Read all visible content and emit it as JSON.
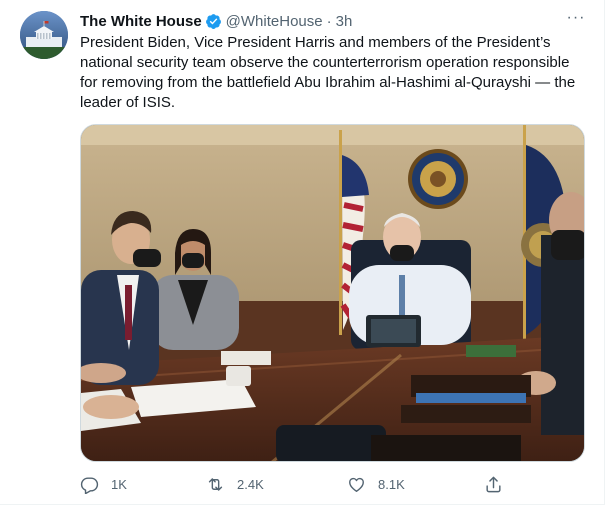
{
  "tweet": {
    "author_name": "The White House",
    "handle": "@WhiteHouse",
    "separator": "·",
    "time": "3h",
    "more_label": "···",
    "text": "President Biden, Vice President Harris and members of the President’s national security team observe the counterterrorism operation responsible for removing from the battlefield Abu Ibrahim al-Hashimi al-Qurayshi — the leader of ISIS."
  },
  "actions": {
    "replies": "1K",
    "retweets": "2.4K",
    "likes": "8.1K"
  },
  "icons": {
    "verified": "verified-badge-icon",
    "reply": "reply-icon",
    "retweet": "retweet-icon",
    "like": "heart-icon",
    "share": "share-icon",
    "more": "more-icon"
  },
  "colors": {
    "text": "#0f1419",
    "secondary": "#536471",
    "verified": "#1d9bf0",
    "border": "#cfd9de"
  }
}
